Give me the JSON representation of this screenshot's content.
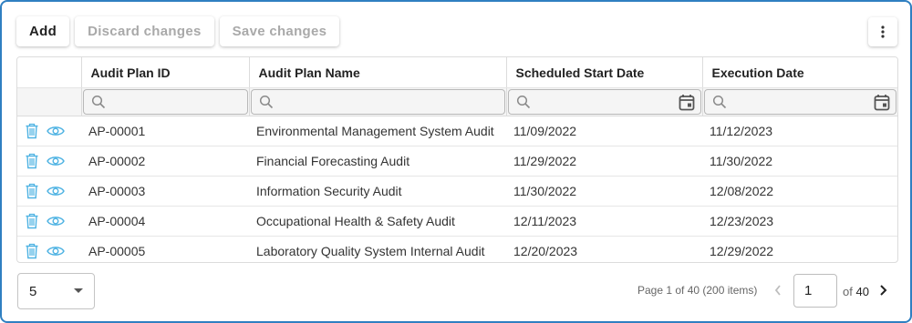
{
  "toolbar": {
    "add_label": "Add",
    "discard_label": "Discard changes",
    "save_label": "Save changes"
  },
  "table": {
    "columns": [
      "Audit Plan ID",
      "Audit Plan Name",
      "Scheduled Start Date",
      "Execution Date"
    ],
    "rows": [
      {
        "id": "AP-00001",
        "name": "Environmental Management System Audit",
        "start": "11/09/2022",
        "exec": "11/12/2023"
      },
      {
        "id": "AP-00002",
        "name": "Financial Forecasting Audit",
        "start": "11/29/2022",
        "exec": "11/30/2022"
      },
      {
        "id": "AP-00003",
        "name": "Information Security Audit",
        "start": "11/30/2022",
        "exec": "12/08/2022"
      },
      {
        "id": "AP-00004",
        "name": "Occupational Health & Safety Audit",
        "start": "12/11/2023",
        "exec": "12/23/2023"
      },
      {
        "id": "AP-00005",
        "name": "Laboratory Quality System Internal Audit",
        "start": "12/20/2023",
        "exec": "12/29/2022"
      }
    ]
  },
  "pager": {
    "page_size": "5",
    "info": "Page 1 of 40 (200 items)",
    "current_page": "1",
    "of_label": "of",
    "total_pages": "40"
  },
  "colors": {
    "accent": "#2f7fc1",
    "action_icon": "#4fb3e3"
  },
  "icons": {
    "row_actions": [
      "trash-icon",
      "eye-icon"
    ],
    "filter": "search-icon",
    "date": "calendar-icon",
    "menu": "more-vertical-icon"
  }
}
